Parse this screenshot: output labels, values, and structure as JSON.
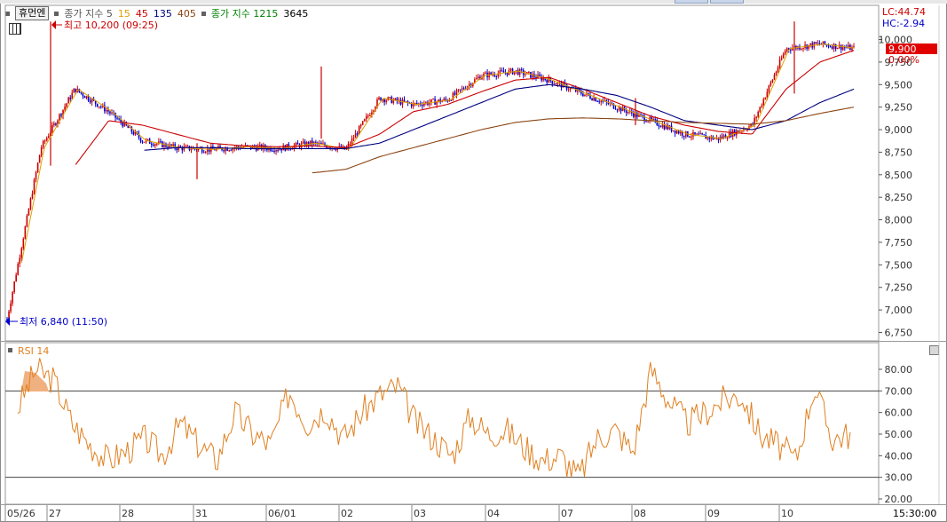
{
  "header": {
    "stock_name": "휴먼엔",
    "ma_label_prefix": "종가 지수 5",
    "ma_periods": [
      {
        "label": "15",
        "color": "#e0a000"
      },
      {
        "label": "45",
        "color": "#cc0000"
      },
      {
        "label": "135",
        "color": "#000080"
      },
      {
        "label": "405",
        "color": "#8b4513"
      }
    ],
    "vol_ma_label_prefix": "종가 지수 1215",
    "vol_ma_value": "3645"
  },
  "price_panel": {
    "high_annotation": "최고 10,200 (09:25)",
    "low_annotation": "최저 6,840 (11:50)",
    "lc_label": "LC:44.74",
    "hc_label": "HC:-2.94",
    "current_price": "9,900",
    "current_change": "0.00%",
    "y_ticks": [
      "10,000",
      "9,750",
      "9,500",
      "9,250",
      "9,000",
      "8,750",
      "8,500",
      "8,250",
      "8,000",
      "7,750",
      "7,500",
      "7,250",
      "7,000",
      "6,750"
    ],
    "y_tick_values": [
      10000,
      9750,
      9500,
      9250,
      9000,
      8750,
      8500,
      8250,
      8000,
      7750,
      7500,
      7250,
      7000,
      6750
    ]
  },
  "rsi_panel": {
    "label": "RSI 14",
    "y_ticks": [
      "80.00",
      "70.00",
      "60.00",
      "50.00",
      "40.00",
      "30.00",
      "20.00"
    ],
    "y_tick_values": [
      80,
      70,
      60,
      50,
      40,
      30,
      20
    ]
  },
  "x_axis": {
    "labels": [
      "05/26",
      "27",
      "28",
      "31",
      "06/01",
      "02",
      "03",
      "04",
      "07",
      "08",
      "09",
      "10"
    ],
    "time_label": "15:30:00"
  },
  "colors": {
    "candle_up": "#cc0000",
    "candle_down": "#0000cc",
    "ma5": "#e0a000",
    "ma15": "#cc0000",
    "ma45": "#000080",
    "ma135": "#8b4513",
    "rsi": "#e08020",
    "current_price_bg": "#e00000"
  },
  "chart_data": {
    "type": "line",
    "xlabel": "",
    "ylabel": "",
    "ylim": [
      6700,
      10250
    ],
    "x_categories": [
      "05/26",
      "27",
      "28",
      "31",
      "06/01",
      "02",
      "03",
      "04",
      "07",
      "08",
      "09",
      "10"
    ],
    "series": [
      {
        "name": "종가",
        "values": [
          6900,
          8800,
          9450,
          9200,
          8880,
          8800,
          8780,
          8810,
          8790,
          8850,
          8780,
          9350,
          9280,
          9330,
          9600,
          9650,
          9550,
          9400,
          9250,
          9100,
          8950,
          8900,
          9050,
          9900,
          9950,
          9900
        ]
      },
      {
        "name": "45",
        "values": [
          null,
          null,
          8600,
          9100,
          9050,
          8950,
          8850,
          8820,
          8810,
          8820,
          8800,
          8950,
          9200,
          9280,
          9420,
          9550,
          9580,
          9450,
          9300,
          9150,
          9050,
          8980,
          8950,
          9450,
          9750,
          9880
        ]
      },
      {
        "name": "135",
        "values": [
          null,
          null,
          null,
          null,
          8770,
          8800,
          8800,
          8790,
          8790,
          8790,
          8790,
          8850,
          9000,
          9150,
          9300,
          9450,
          9500,
          9450,
          9380,
          9250,
          9100,
          9050,
          9000,
          9100,
          9300,
          9450
        ]
      },
      {
        "name": "405",
        "values": [
          null,
          null,
          null,
          null,
          null,
          null,
          null,
          null,
          null,
          8520,
          8560,
          8700,
          8800,
          8900,
          9000,
          9080,
          9120,
          9130,
          9120,
          9100,
          9080,
          9070,
          9060,
          9100,
          9180,
          9250
        ]
      }
    ],
    "rsi": {
      "name": "RSI 14",
      "values": [
        62,
        80,
        75,
        55,
        45,
        38,
        42,
        48,
        40,
        55,
        45,
        38,
        60,
        50,
        45,
        70,
        55,
        62,
        48,
        60,
        68,
        72,
        55,
        48,
        40,
        58,
        50,
        52,
        44,
        38,
        40,
        30,
        48,
        52,
        42,
        80,
        65,
        55,
        60,
        66,
        68,
        50,
        45,
        38,
        72,
        48,
        50
      ],
      "ylim": [
        15,
        90
      ],
      "reference_lines": [
        70,
        30
      ]
    }
  }
}
